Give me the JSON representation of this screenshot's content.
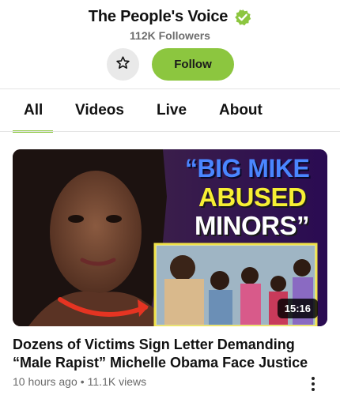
{
  "channel": {
    "name": "The People's Voice",
    "followers": "112K Followers",
    "verified_color": "#8cc63f",
    "follow_label": "Follow",
    "favorite_icon": "star-outline-icon"
  },
  "tabs": [
    {
      "label": "All",
      "active": true
    },
    {
      "label": "Videos",
      "active": false
    },
    {
      "label": "Live",
      "active": false
    },
    {
      "label": "About",
      "active": false
    }
  ],
  "video": {
    "thumbnail_text": {
      "line1": "“BIG MIKE",
      "line2": "ABUSED",
      "line3": "MINORS”"
    },
    "duration": "15:16",
    "title": "Dozens of Victims Sign Letter Demanding “Male Rapist” Michelle Obama Face Justice",
    "age": "10 hours ago",
    "views": "11.1K views",
    "more_icon": "more-vertical-icon"
  },
  "colors": {
    "accent": "#8cc63f",
    "text": "#111111",
    "muted": "#6a6a6a"
  }
}
